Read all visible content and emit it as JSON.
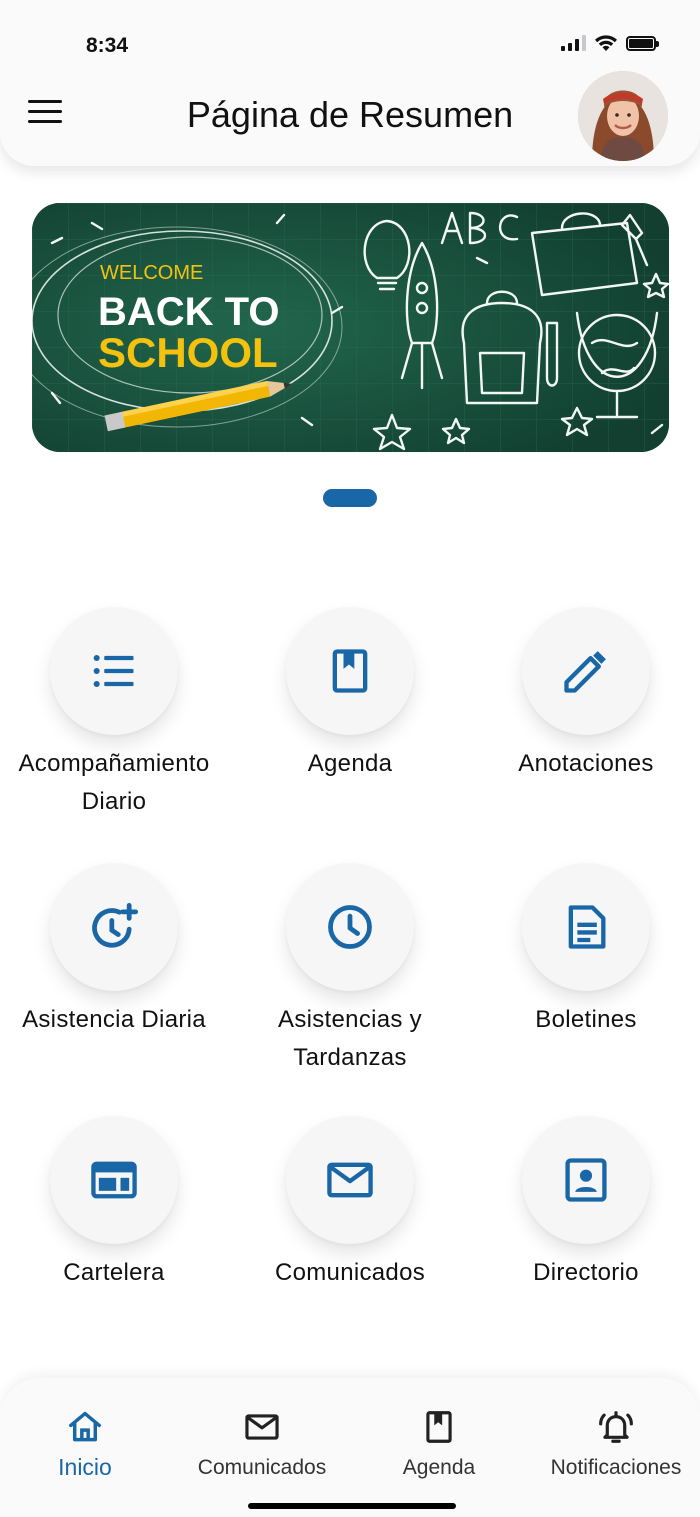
{
  "status_bar": {
    "time": "8:34",
    "icons": [
      "cellular-signal-icon",
      "wifi-icon",
      "battery-icon"
    ]
  },
  "header": {
    "title": "Página de Resumen",
    "menu_icon": "hamburger-menu-icon",
    "avatar": "user-avatar-photo"
  },
  "banner": {
    "welcome": "WELCOME",
    "line1": "BACK TO",
    "line2": "SCHOOL",
    "carousel_position": 1,
    "carousel_count": 1
  },
  "menu": [
    {
      "label": "Acompañamiento Diario",
      "icon": "list-icon"
    },
    {
      "label": "Agenda",
      "icon": "bookmark-book-icon"
    },
    {
      "label": "Anotaciones",
      "icon": "pencil-icon"
    },
    {
      "label": "Asistencia Diaria",
      "icon": "clock-plus-icon"
    },
    {
      "label": "Asistencias y Tardanzas",
      "icon": "clock-icon"
    },
    {
      "label": "Boletines",
      "icon": "document-icon"
    },
    {
      "label": "Cartelera",
      "icon": "billboard-icon"
    },
    {
      "label": "Comunicados",
      "icon": "mail-icon"
    },
    {
      "label": "Directorio",
      "icon": "contact-card-icon"
    }
  ],
  "bottom_nav": [
    {
      "label": "Inicio",
      "icon": "home-icon",
      "active": true
    },
    {
      "label": "Comunicados",
      "icon": "mail-icon",
      "active": false
    },
    {
      "label": "Agenda",
      "icon": "bookmark-book-icon",
      "active": false
    },
    {
      "label": "Notificaciones",
      "icon": "bell-ringing-icon",
      "active": false
    }
  ],
  "colors": {
    "accent": "#1a67a8",
    "banner_green": "#174f3c",
    "banner_yellow": "#f4c20d"
  }
}
